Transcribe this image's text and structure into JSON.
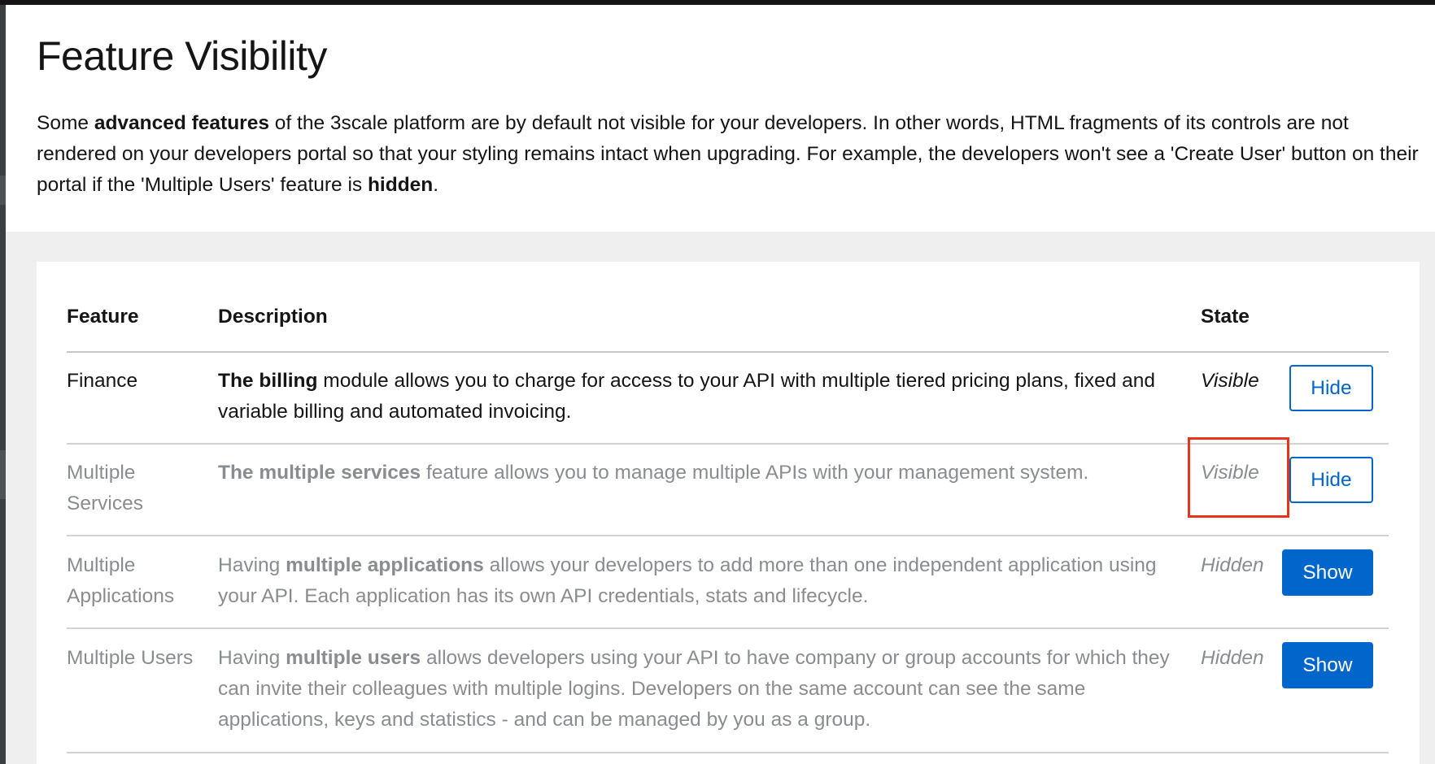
{
  "page": {
    "title": "Feature Visibility",
    "intro": {
      "t1": "Some ",
      "b1": "advanced features",
      "t2": " of the 3scale platform are by default not visible for your developers. In other words, HTML fragments of its controls are not rendered on your developers portal so that your styling remains intact when upgrading. For example, the developers won't see a 'Create User' button on their portal if the 'Multiple Users' feature is ",
      "b2": "hidden",
      "t3": "."
    }
  },
  "table": {
    "headers": {
      "feature": "Feature",
      "description": "Description",
      "state": "State"
    },
    "rows": [
      {
        "feature": "Finance",
        "desc_bold": "The billing",
        "desc_pre": "",
        "desc_post": " module allows you to charge for access to your API with multiple tiered pricing plans, fixed and variable billing and automated invoicing.",
        "state": "Visible",
        "action": "Hide"
      },
      {
        "feature": "Multiple Services",
        "desc_bold": "The multiple services",
        "desc_pre": "",
        "desc_post": " feature allows you to manage multiple APIs with your management system.",
        "state": "Visible",
        "action": "Hide"
      },
      {
        "feature": "Multiple Applications",
        "desc_pre": "Having ",
        "desc_bold": "multiple applications",
        "desc_post": " allows your developers to add more than one independent application using your API. Each application has its own API credentials, stats and lifecycle.",
        "state": "Hidden",
        "action": "Show"
      },
      {
        "feature": "Multiple Users",
        "desc_pre": "Having ",
        "desc_bold": "multiple users",
        "desc_post": " allows developers using your API to have company or group accounts for which they can invite their colleagues with multiple logins. Developers on the same account can see the same applications, keys and statistics - and can be managed by you as a group.",
        "state": "Hidden",
        "action": "Show"
      }
    ]
  },
  "colors": {
    "primary": "#0066cc",
    "highlight_box": "#e8341c",
    "muted_text": "#8a8d90"
  }
}
